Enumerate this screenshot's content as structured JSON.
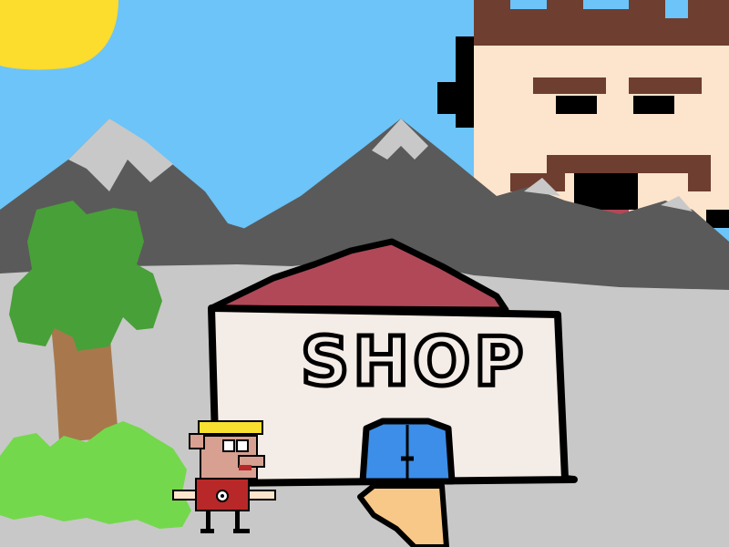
{
  "scene": {
    "shop_sign": "SHOP"
  },
  "colors": {
    "sky": "#6cc4f8",
    "sun": "#fcdc2c",
    "mountains": "#5a5a5a",
    "snow": "#c8c8c8",
    "ground": "#c8c8c8",
    "giant_skin": "#fde4cc",
    "giant_hair": "#6e3e30",
    "roof": "#b04858",
    "shop_wall": "#f4ece6",
    "door": "#3c8ee8",
    "path": "#f8c888",
    "tree_leaves": "#48a038",
    "tree_trunk": "#a8784c",
    "bush": "#74d84c",
    "player_hair": "#f8e030",
    "player_shirt": "#b82828"
  }
}
